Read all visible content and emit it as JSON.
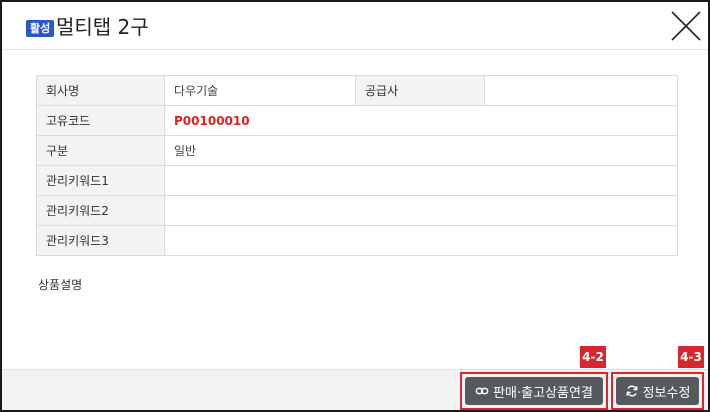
{
  "header": {
    "badge": "활성",
    "title": "멀티탭 2구",
    "close_icon": "close-icon"
  },
  "info_table": {
    "rows": [
      [
        {
          "label": "회사명",
          "value": "다우기술"
        },
        {
          "label": "공급사",
          "value": ""
        }
      ],
      [
        {
          "label": "고유코드",
          "value": "P00100010"
        }
      ],
      [
        {
          "label": "구분",
          "value": "일반"
        }
      ],
      [
        {
          "label": "관리키워드1",
          "value": ""
        }
      ],
      [
        {
          "label": "관리키워드2",
          "value": ""
        }
      ],
      [
        {
          "label": "관리키워드3",
          "value": ""
        }
      ]
    ]
  },
  "description_label": "상품설명",
  "footer": {
    "link_button": {
      "label": "판매·출고상품연결",
      "icon": "link-icon",
      "marker": "4-2"
    },
    "edit_button": {
      "label": "정보수정",
      "icon": "refresh-icon",
      "marker": "4-3"
    }
  },
  "colors": {
    "badge": "#2b56c9",
    "code_text": "#e02020",
    "marker": "#d8262d",
    "button": "#555a5f"
  }
}
